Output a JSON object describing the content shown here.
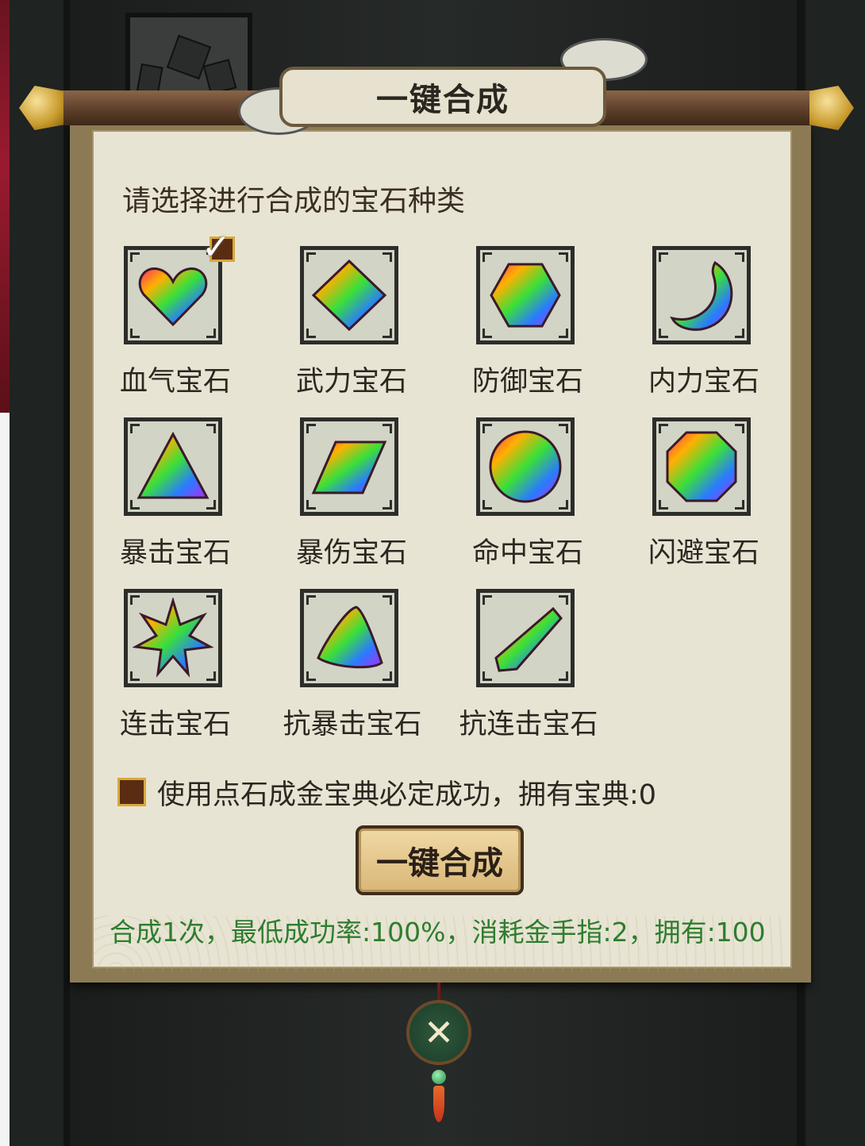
{
  "dialog": {
    "title": "一键合成",
    "prompt": "请选择进行合成的宝石种类"
  },
  "gems": [
    {
      "label": "血气宝石",
      "icon": "heart-gem-icon",
      "selected": true
    },
    {
      "label": "武力宝石",
      "icon": "diamond-gem-icon",
      "selected": false
    },
    {
      "label": "防御宝石",
      "icon": "hexagon-gem-icon",
      "selected": false
    },
    {
      "label": "内力宝石",
      "icon": "crescent-gem-icon",
      "selected": false
    },
    {
      "label": "暴击宝石",
      "icon": "triangle-gem-icon",
      "selected": false
    },
    {
      "label": "暴伤宝石",
      "icon": "parallelogram-gem-icon",
      "selected": false
    },
    {
      "label": "命中宝石",
      "icon": "round-gem-icon",
      "selected": false
    },
    {
      "label": "闪避宝石",
      "icon": "octagon-gem-icon",
      "selected": false
    },
    {
      "label": "连击宝石",
      "icon": "star-gem-icon",
      "selected": false
    },
    {
      "label": "抗暴击宝石",
      "icon": "trillion-gem-icon",
      "selected": false
    },
    {
      "label": "抗连击宝石",
      "icon": "crystal-shard-gem-icon",
      "selected": false
    }
  ],
  "option": {
    "label": "使用点石成金宝典必定成功，拥有宝典:0",
    "checked": false
  },
  "button": {
    "label": "一键合成"
  },
  "status": "合成1次，最低成功率:100%，消耗金手指:2，拥有:100",
  "close": {
    "icon": "close-icon"
  },
  "colors": {
    "status_text": "#2e7d2e",
    "paper": "#e8e4d4",
    "checkbox": "#5a2c12",
    "checkbox_border": "#d9a83a"
  }
}
